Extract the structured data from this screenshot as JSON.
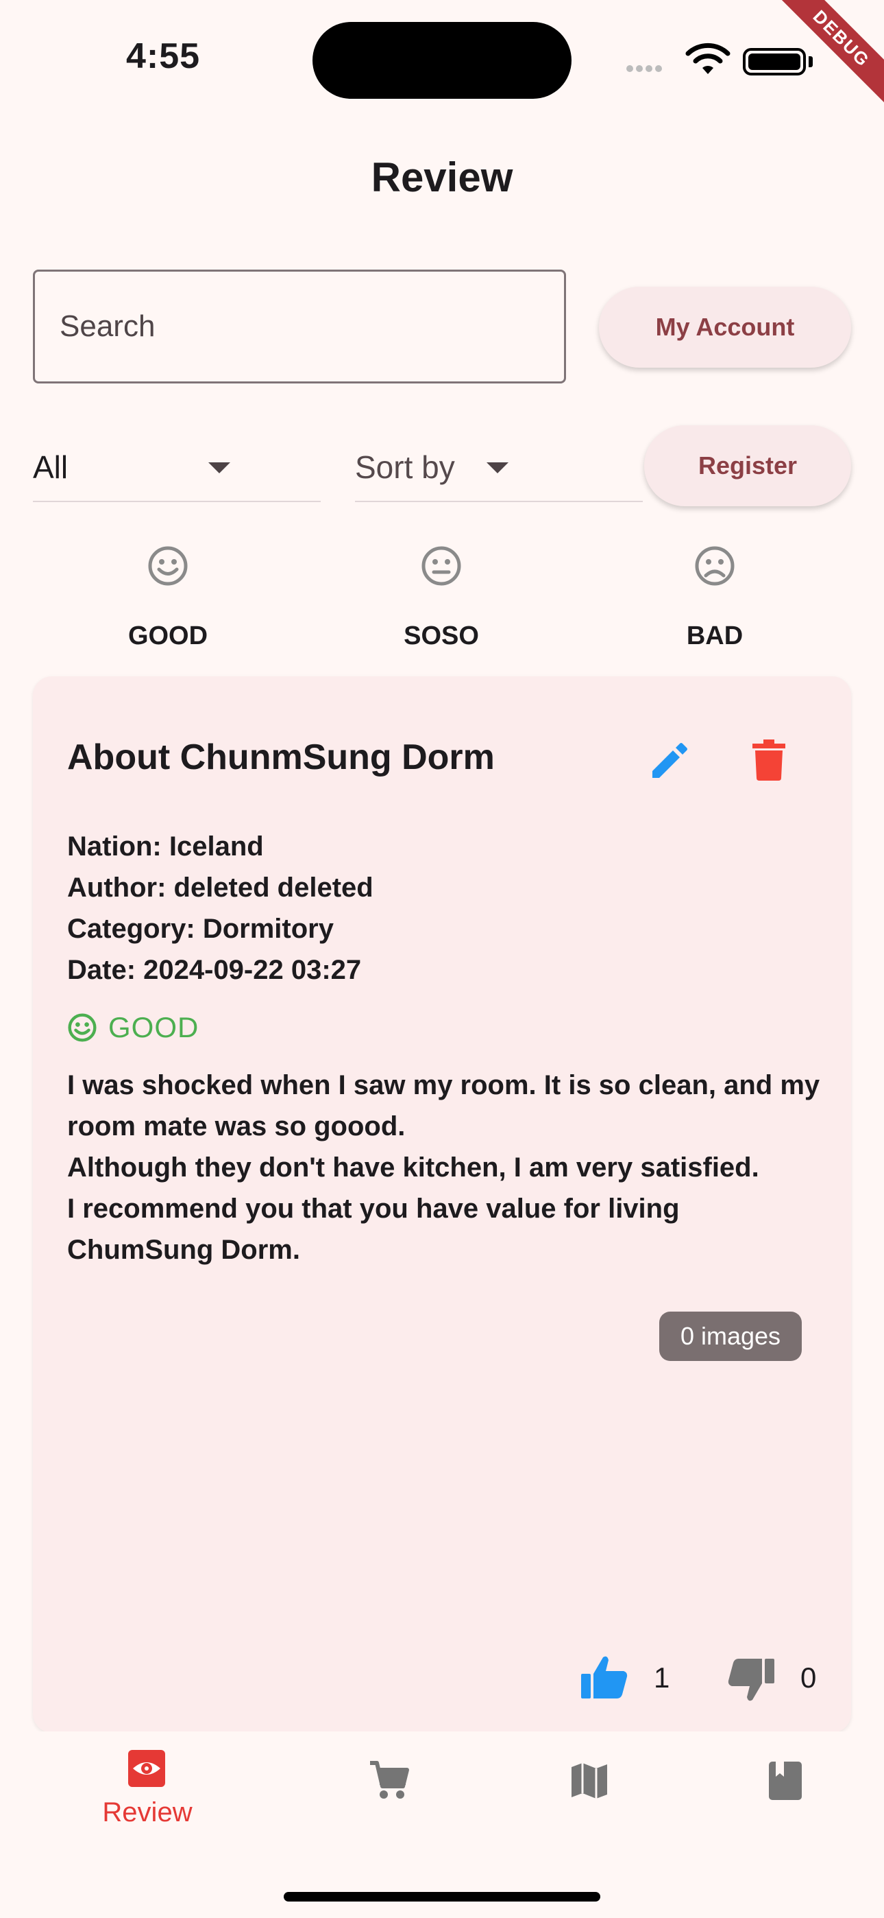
{
  "status_bar": {
    "time": "4:55"
  },
  "debug_banner": "DEBUG",
  "header": {
    "title": "Review"
  },
  "search": {
    "placeholder": "Search"
  },
  "buttons": {
    "my_account": "My Account",
    "register": "Register"
  },
  "filters": {
    "category_selected": "All",
    "sort_label": "Sort by"
  },
  "ratings": [
    {
      "label": "GOOD",
      "icon": "smile-icon"
    },
    {
      "label": "SOSO",
      "icon": "neutral-face-icon"
    },
    {
      "label": "BAD",
      "icon": "sad-face-icon"
    }
  ],
  "review": {
    "title": "About ChunmSung Dorm",
    "nation": "Nation: Iceland",
    "author": "Author: deleted deleted",
    "category": "Category: Dormitory",
    "date": "Date: 2024-09-22 03:27",
    "rating": "GOOD",
    "body": "I was shocked when I saw my room. It is so clean, and my room mate was so goood.\nAlthough they don't have kitchen, I am very satisfied.\nI recommend you that you have value for living ChumSung Dorm.",
    "images_badge": "0 images",
    "likes": "1",
    "dislikes": "0"
  },
  "nav": {
    "items": [
      {
        "label": "Review",
        "icon": "eye-icon",
        "active": true
      },
      {
        "label": "",
        "icon": "cart-icon"
      },
      {
        "label": "",
        "icon": "map-icon"
      },
      {
        "label": "",
        "icon": "book-icon"
      }
    ]
  },
  "colors": {
    "background": "#fff7f5",
    "card": "#fcecec",
    "accent": "#8c3f45",
    "good": "#4caf50",
    "edit": "#2196f3",
    "delete": "#f44336",
    "nav_active": "#e53935"
  }
}
